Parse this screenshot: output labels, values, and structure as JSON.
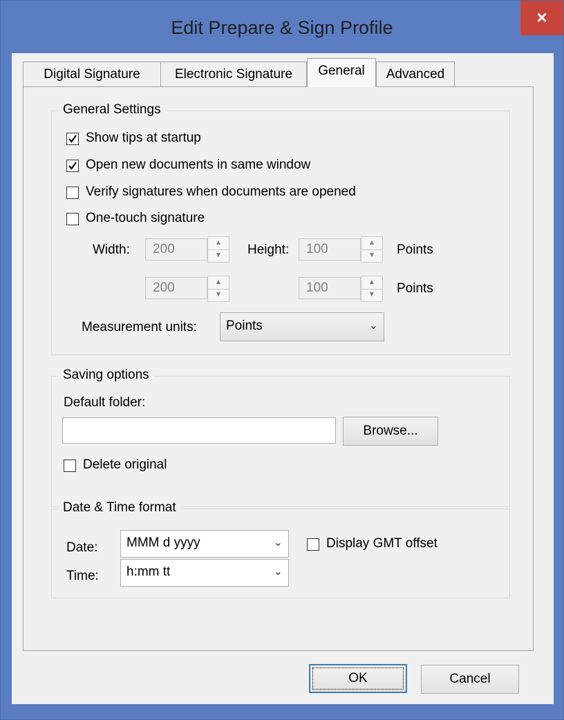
{
  "window": {
    "title": "Edit Prepare & Sign Profile",
    "close_symbol": "×"
  },
  "tabs": [
    {
      "label": "Digital Signature",
      "active": false
    },
    {
      "label": "Electronic Signature",
      "active": false
    },
    {
      "label": "General",
      "active": true
    },
    {
      "label": "Advanced",
      "active": false
    }
  ],
  "general_settings": {
    "title": "General Settings",
    "options": [
      {
        "label": "Show tips at startup",
        "checked": true
      },
      {
        "label": "Open new documents in same window",
        "checked": true
      },
      {
        "label": "Verify signatures when documents are opened",
        "checked": false
      },
      {
        "label": "One-touch signature",
        "checked": false
      }
    ],
    "width_label": "Width:",
    "height_label": "Height:",
    "width_value": "200",
    "height_value": "100",
    "width_value_2": "200",
    "height_value_2": "100",
    "units_label_1": "Points",
    "units_label_2": "Points",
    "measurement_label": "Measurement units:",
    "measurement_value": "Points"
  },
  "saving_options": {
    "title": "Saving options",
    "default_folder_label": "Default folder:",
    "default_folder_value": "",
    "browse_label": "Browse...",
    "delete_original_label": "Delete original",
    "delete_original_checked": false
  },
  "date_time": {
    "title": "Date & Time format",
    "date_label": "Date:",
    "date_value": "MMM d yyyy",
    "time_label": "Time:",
    "time_value": "h:mm tt",
    "gmt_label": "Display GMT offset",
    "gmt_checked": false
  },
  "footer": {
    "ok_label": "OK",
    "cancel_label": "Cancel"
  },
  "colors": {
    "title_bar": "#5b7ec2",
    "close_button": "#c7443b",
    "dialog_bg": "#f0f0f0"
  }
}
